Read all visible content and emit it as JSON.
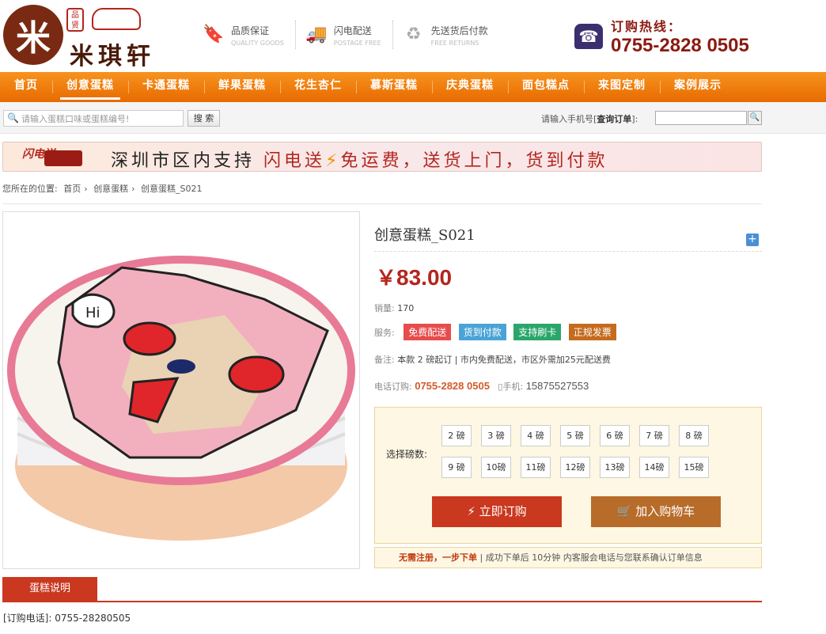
{
  "brand": {
    "seal": "品贤",
    "name": "米琪轩",
    "mark": "米"
  },
  "badges": [
    {
      "title": "品质保证",
      "sub": "QUALITY GOODS",
      "icon": "bookmark-icon"
    },
    {
      "title": "闪电配送",
      "sub": "POSTAGE FREE",
      "icon": "truck-icon"
    },
    {
      "title": "先送货后付款",
      "sub": "FREE RETURNS",
      "icon": "return-icon"
    }
  ],
  "hotline": {
    "label": "订购热线：",
    "number": "0755-2828 0505"
  },
  "nav": [
    "首页",
    "创意蛋糕",
    "卡通蛋糕",
    "鲜果蛋糕",
    "花生杏仁",
    "慕斯蛋糕",
    "庆典蛋糕",
    "面包糕点",
    "来图定制",
    "案例展示"
  ],
  "search": {
    "placeholder": "请输入蛋糕口味或蛋糕编号!",
    "button": "搜 索",
    "query_prefix": "请输入手机号[",
    "query_strong": "查询订单",
    "query_suffix": "]:"
  },
  "banner": {
    "logo": "闪电送",
    "text1": "深圳市区内支持",
    "text2": "闪电送",
    "bolt": "⚡",
    "text3": "免运费，送货上门，货到付款"
  },
  "breadcrumb": {
    "prefix": "您所在的位置:",
    "items": [
      "首页",
      "创意蛋糕",
      "创意蛋糕_S021"
    ],
    "sep": "›"
  },
  "product": {
    "title": "创意蛋糕_S021",
    "currency": "￥",
    "price": "83.00",
    "sales_label": "销量:",
    "sales": "170",
    "service_label": "服务:",
    "services": [
      "免费配送",
      "货到付款",
      "支持刷卡",
      "正规发票"
    ],
    "note_label": "备注:",
    "note": "本款 2 磅起订 | 市内免费配送，市区外需加25元配送费",
    "tel_label": "电话订购:",
    "tel": "0755-2828 0505",
    "mobile_label": "手机:",
    "mobile": "15875527553",
    "weight_label": "选择磅数:",
    "weights": [
      "2 磅",
      "3 磅",
      "4 磅",
      "5 磅",
      "6 磅",
      "7 磅",
      "8 磅",
      "9 磅",
      "10磅",
      "11磅",
      "12磅",
      "13磅",
      "14磅",
      "15磅"
    ],
    "buy": "立即订购",
    "cart": "加入购物车",
    "notice_red": "无需注册，一步下单",
    "notice": "成功下单后 10分钟 内客服会电话与您联系确认订单信息",
    "plus": "+"
  },
  "tab": "蛋糕说明",
  "order_phone": "[订购电话]: 0755-28280505",
  "colors": {
    "nav": "#f7931e",
    "accent": "#c9381f",
    "price": "#b3261e"
  }
}
